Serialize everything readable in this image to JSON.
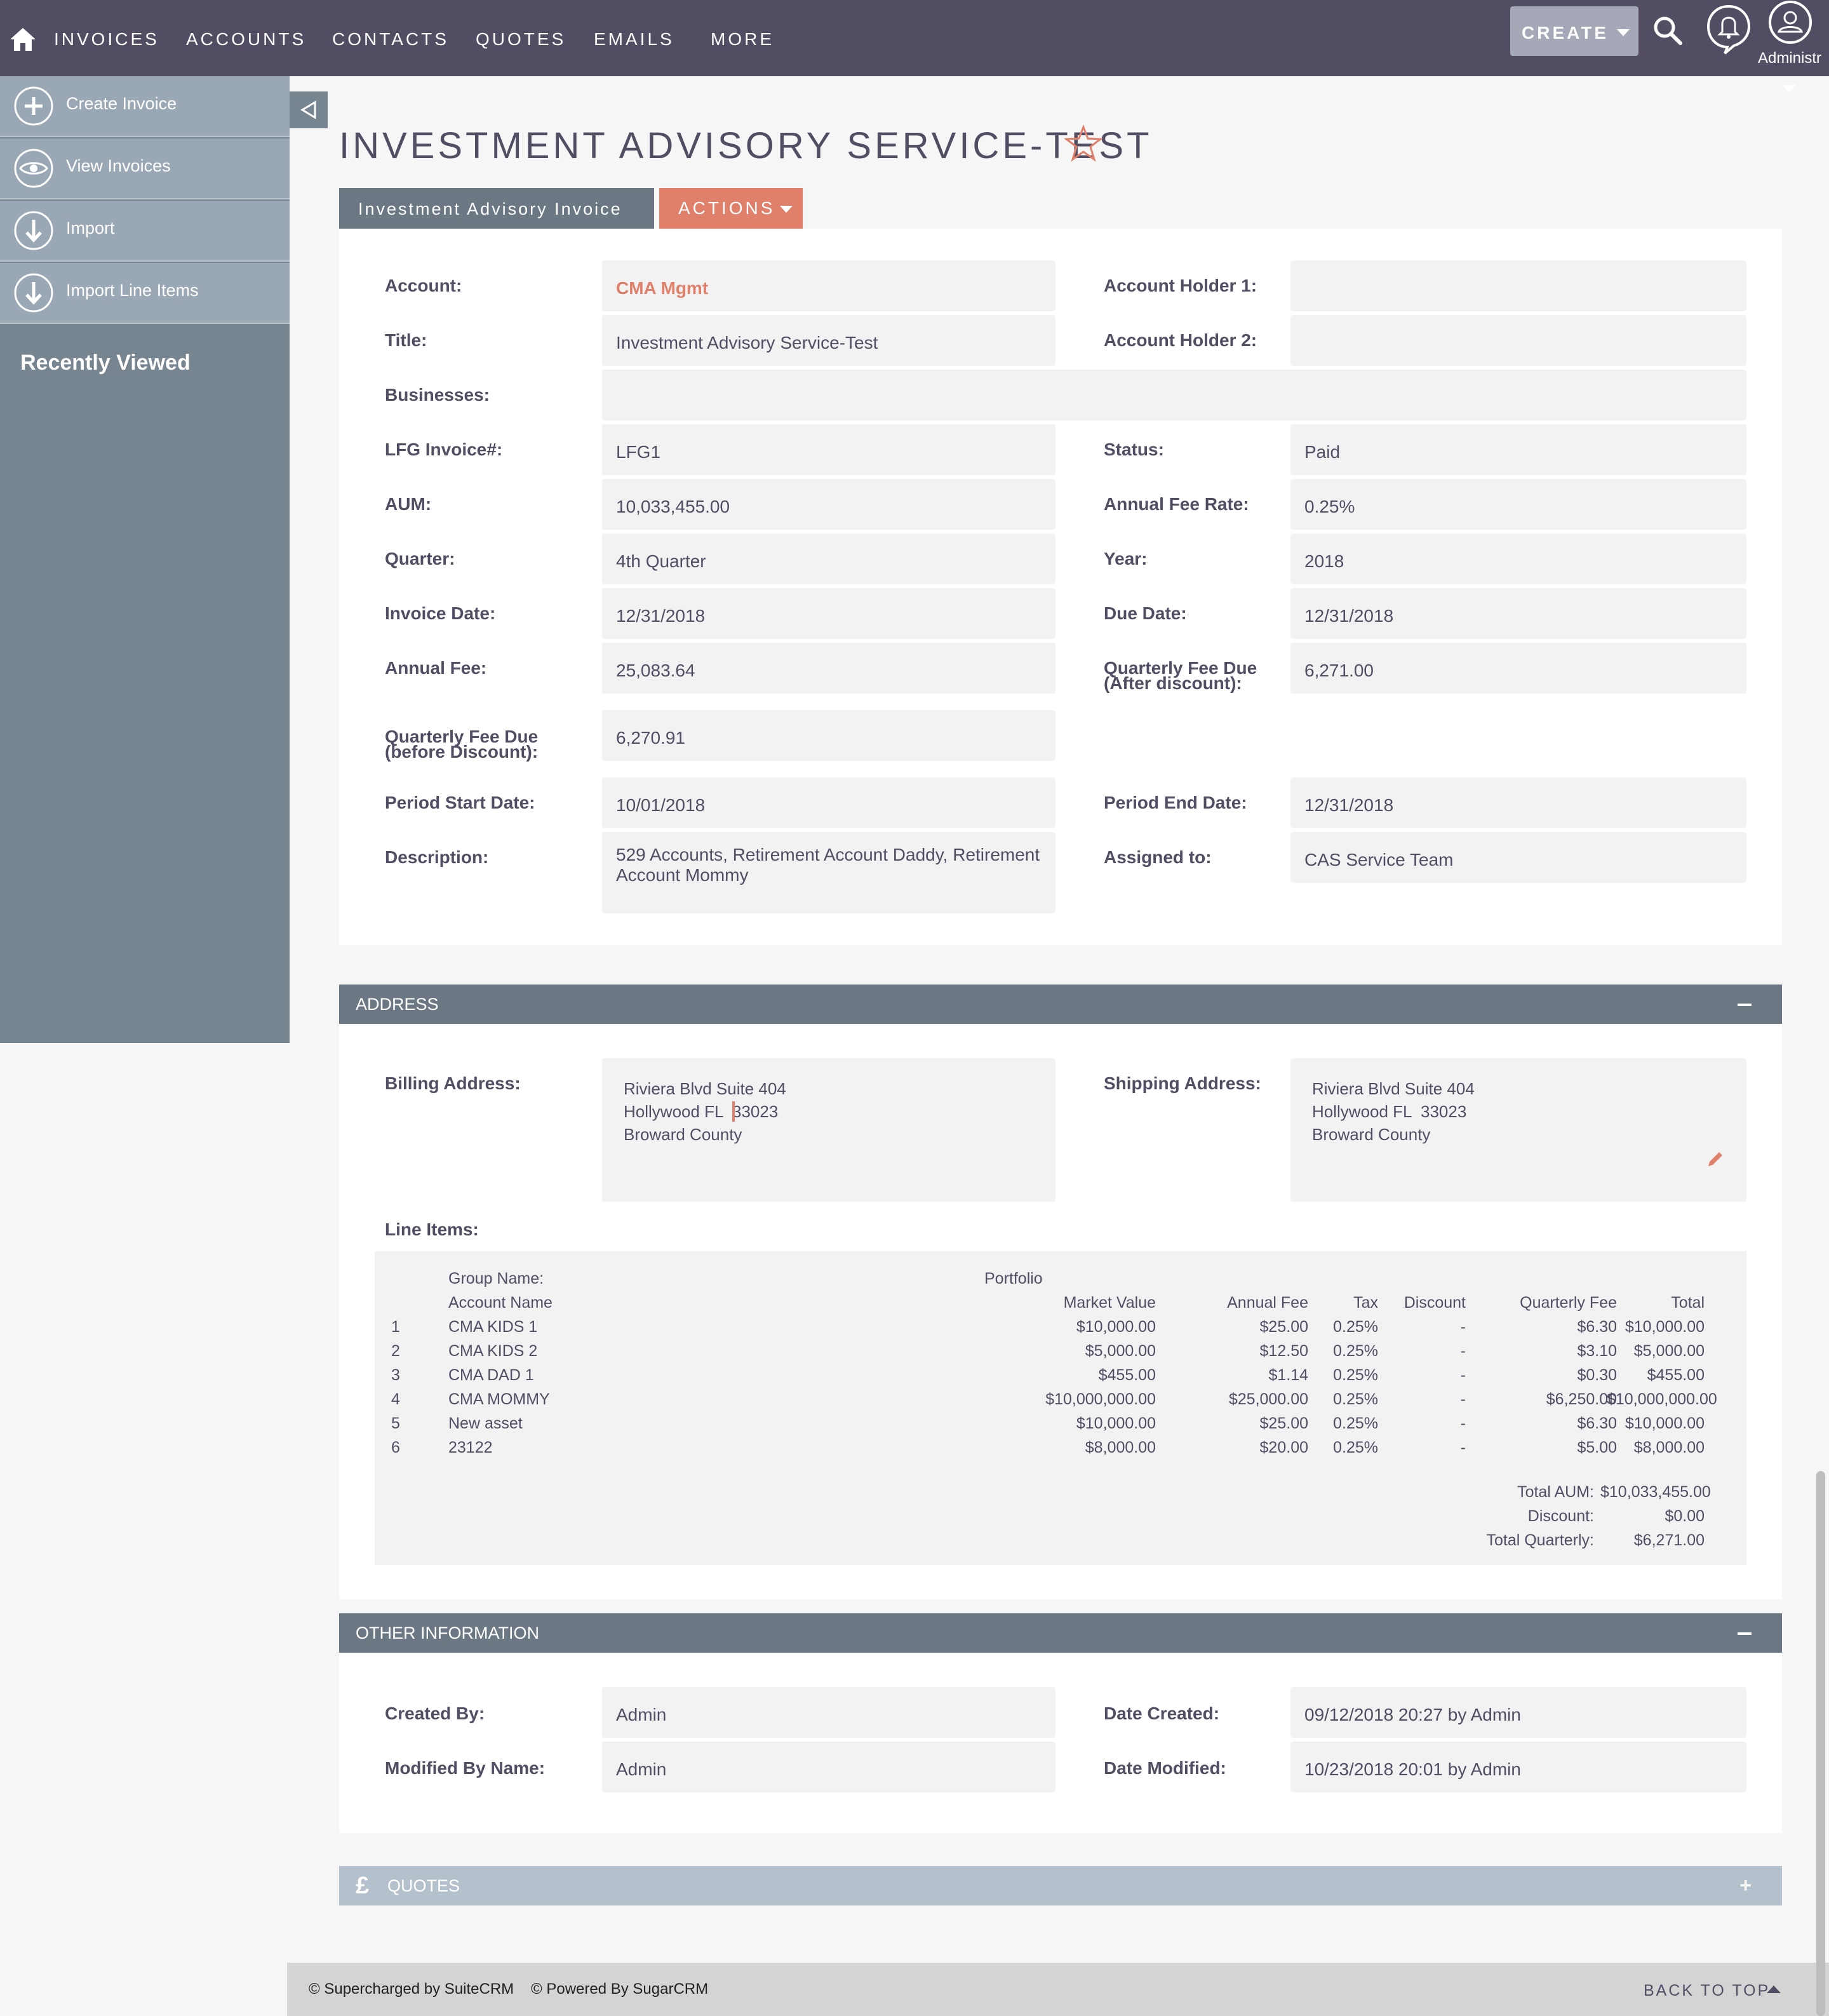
{
  "nav": {
    "items": [
      "INVOICES",
      "ACCOUNTS",
      "CONTACTS",
      "QUOTES",
      "EMAILS",
      "MORE"
    ],
    "create_label": "CREATE",
    "user_label": "Administr"
  },
  "sidebar": {
    "actions": [
      {
        "label": "Create Invoice",
        "icon": "plus-circle-icon"
      },
      {
        "label": "View Invoices",
        "icon": "eye-icon"
      },
      {
        "label": "Import",
        "icon": "download-icon"
      },
      {
        "label": "Import Line Items",
        "icon": "download-icon"
      }
    ],
    "recently_viewed": "Recently Viewed"
  },
  "page": {
    "title": "INVESTMENT ADVISORY SERVICE-TEST",
    "tab_label": "Investment Advisory Invoice",
    "actions_label": "ACTIONS"
  },
  "details": {
    "account_label": "Account:",
    "account": "CMA Mgmt",
    "holder1_label": "Account Holder 1:",
    "holder1": "",
    "title_label": "Title:",
    "title": "Investment Advisory Service-Test",
    "holder2_label": "Account Holder 2:",
    "holder2": "",
    "businesses_label": "Businesses:",
    "businesses": "",
    "invoice_no_label": "LFG Invoice#:",
    "invoice_no": "LFG1",
    "status_label": "Status:",
    "status": "Paid",
    "aum_label": "AUM:",
    "aum": "10,033,455.00",
    "fee_rate_label": "Annual Fee Rate:",
    "fee_rate": "0.25%",
    "quarter_label": "Quarter:",
    "quarter": "4th Quarter",
    "year_label": "Year:",
    "year": "2018",
    "invoice_date_label": "Invoice Date:",
    "invoice_date": "12/31/2018",
    "due_date_label": "Due Date:",
    "due_date": "12/31/2018",
    "annual_fee_label": "Annual Fee:",
    "annual_fee": "25,083.64",
    "qfee_after_label_1": "Quarterly Fee Due",
    "qfee_after_label_2": "(After discount):",
    "qfee_after": "6,271.00",
    "qfee_before_label_1": "Quarterly Fee Due",
    "qfee_before_label_2": "(before Discount):",
    "qfee_before": "6,270.91",
    "period_start_label": "Period Start Date:",
    "period_start": "10/01/2018",
    "period_end_label": "Period End Date:",
    "period_end": "12/31/2018",
    "description_label": "Description:",
    "description": "529 Accounts, Retirement Account Daddy, Retirement Account Mommy",
    "assigned_label": "Assigned to:",
    "assigned": "CAS Service Team"
  },
  "address": {
    "header": "ADDRESS",
    "billing_label": "Billing Address:",
    "billing_line1": "Riviera Blvd Suite 404",
    "billing_line2": "Hollywood FL  33023",
    "billing_line3": "Broward County",
    "shipping_label": "Shipping Address:",
    "shipping_line1": "Riviera Blvd Suite 404",
    "shipping_line2": "Hollywood FL  33023",
    "shipping_line3": "Broward County",
    "line_items_label": "Line Items:"
  },
  "line_items": {
    "group_label": "Group Name:",
    "group_value": "Portfolio",
    "headers": [
      "Account Name",
      "Market Value",
      "Annual Fee",
      "Tax",
      "Discount",
      "Quarterly Fee",
      "Total"
    ],
    "rows": [
      [
        "1",
        "CMA KIDS 1",
        "$10,000.00",
        "$25.00",
        "0.25%",
        "-",
        "$6.30",
        "$10,000.00"
      ],
      [
        "2",
        "CMA KIDS 2",
        "$5,000.00",
        "$12.50",
        "0.25%",
        "-",
        "$3.10",
        "$5,000.00"
      ],
      [
        "3",
        "CMA DAD 1",
        "$455.00",
        "$1.14",
        "0.25%",
        "-",
        "$0.30",
        "$455.00"
      ],
      [
        "4",
        "CMA MOMMY",
        "$10,000,000.00",
        "$25,000.00",
        "0.25%",
        "-",
        "$6,250.00",
        "$10,000,000.00"
      ],
      [
        "5",
        "New asset",
        "$10,000.00",
        "$25.00",
        "0.25%",
        "-",
        "$6.30",
        "$10,000.00"
      ],
      [
        "6",
        "23122",
        "$8,000.00",
        "$20.00",
        "0.25%",
        "-",
        "$5.00",
        "$8,000.00"
      ]
    ],
    "totals": [
      {
        "label": "Total AUM:",
        "value": "$10,033,455.00"
      },
      {
        "label": "Discount:",
        "value": "$0.00"
      },
      {
        "label": "Total Quarterly:",
        "value": "$6,271.00"
      }
    ]
  },
  "other": {
    "header": "OTHER INFORMATION",
    "created_by_label": "Created By:",
    "created_by": "Admin",
    "date_created_label": "Date Created:",
    "date_created": "09/12/2018 20:27 by Admin",
    "modified_by_label": "Modified By Name:",
    "modified_by": "Admin",
    "date_modified_label": "Date Modified:",
    "date_modified": "10/23/2018 20:01 by Admin"
  },
  "quotes": {
    "header": "QUOTES",
    "currency_symbol": "£"
  },
  "footer": {
    "suitecrm": "© Supercharged by SuiteCRM",
    "sugarcrm": "© Powered By SugarCRM",
    "back_to_top": "BACK TO TOP"
  },
  "colors": {
    "nav_bg": "#534d64",
    "accent": "#e0806a",
    "sidebar": "#778591",
    "section_header": "#6b7884"
  }
}
